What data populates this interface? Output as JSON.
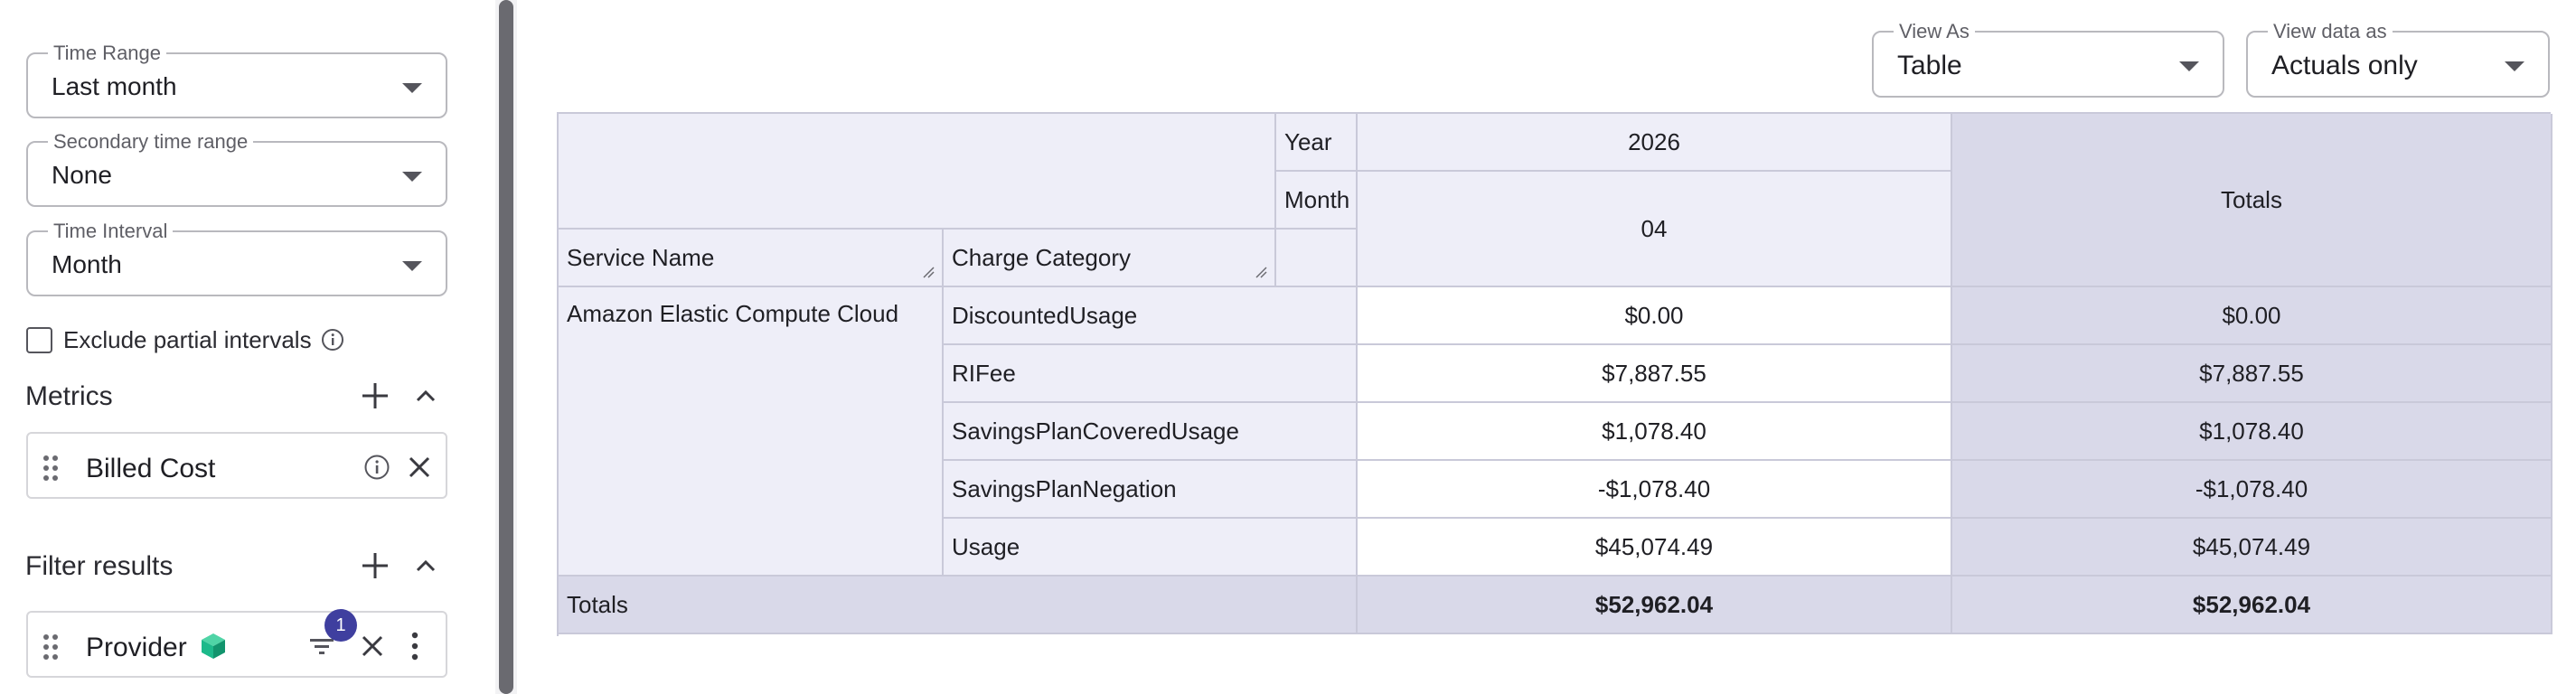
{
  "sidebar": {
    "time_range": {
      "label": "Time Range",
      "value": "Last month"
    },
    "secondary_time_range": {
      "label": "Secondary time range",
      "value": "None"
    },
    "time_interval": {
      "label": "Time Interval",
      "value": "Month"
    },
    "exclude_partial": {
      "label": "Exclude partial intervals",
      "checked": false
    },
    "metrics": {
      "title": "Metrics",
      "items": [
        {
          "label": "Billed Cost"
        }
      ]
    },
    "filters": {
      "title": "Filter results",
      "items": [
        {
          "label": "Provider",
          "badge": "1"
        }
      ]
    }
  },
  "toolbar": {
    "view_as": {
      "label": "View As",
      "value": "Table"
    },
    "view_data_as": {
      "label": "View data as",
      "value": "Actuals only"
    }
  },
  "table": {
    "year_label": "Year",
    "month_label": "Month",
    "year_value": "2026",
    "month_value": "04",
    "totals_label": "Totals",
    "col_service": "Service Name",
    "col_charge": "Charge Category",
    "service": "Amazon Elastic Compute Cloud",
    "rows": [
      {
        "category": "DiscountedUsage",
        "value": "$0.00",
        "total": "$0.00"
      },
      {
        "category": "RIFee",
        "value": "$7,887.55",
        "total": "$7,887.55"
      },
      {
        "category": "SavingsPlanCoveredUsage",
        "value": "$1,078.40",
        "total": "$1,078.40"
      },
      {
        "category": "SavingsPlanNegation",
        "value": "-$1,078.40",
        "total": "-$1,078.40"
      },
      {
        "category": "Usage",
        "value": "$45,074.49",
        "total": "$45,074.49"
      }
    ],
    "footer": {
      "label": "Totals",
      "value": "$52,962.04",
      "total": "$52,962.04"
    }
  },
  "colors": {
    "header_bg": "#eeeef8",
    "totals_bg": "#d9d9e9",
    "badge": "#3f3f9f",
    "provider_icon": "#1db98a"
  }
}
